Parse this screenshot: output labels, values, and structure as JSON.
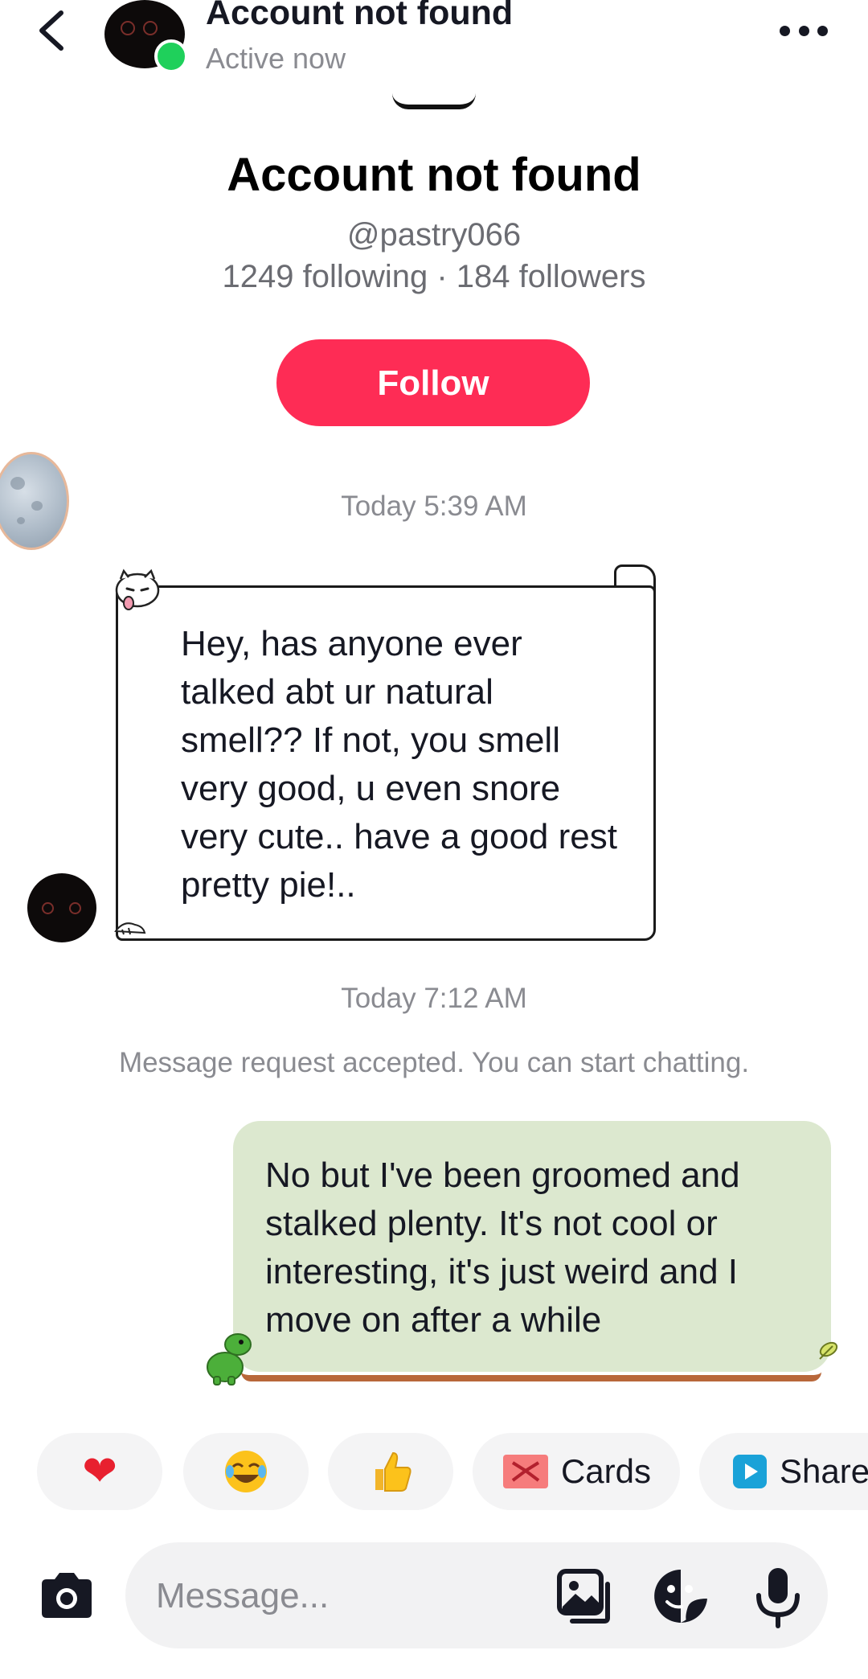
{
  "header": {
    "title": "Account not found",
    "status": "Active now"
  },
  "profile": {
    "name": "Account not found",
    "username": "@pastry066",
    "stats": "1249 following · 184 followers",
    "follow_label": "Follow"
  },
  "conversation": {
    "timestamp_1": "Today 5:39 AM",
    "received_message": "Hey, has anyone ever talked abt ur natural smell?? If not, you smell very good, u even snore very cute.. have a good rest pretty pie!..",
    "timestamp_2": "Today 7:12 AM",
    "system_notice": "Message request accepted. You can start chatting.",
    "sent_message": "No but I've been groomed and stalked plenty. It's not cool or interesting, it's just weird and I move on after a while"
  },
  "quick_replies": {
    "heart": "❤",
    "laugh": "😂",
    "thumbs_up": "👍",
    "cards_label": "Cards",
    "share_label": "Share"
  },
  "composer": {
    "placeholder": "Message..."
  },
  "colors": {
    "follow": "#fe2c55",
    "online": "#1fd05b",
    "sent_bubble": "#dce8cf"
  }
}
